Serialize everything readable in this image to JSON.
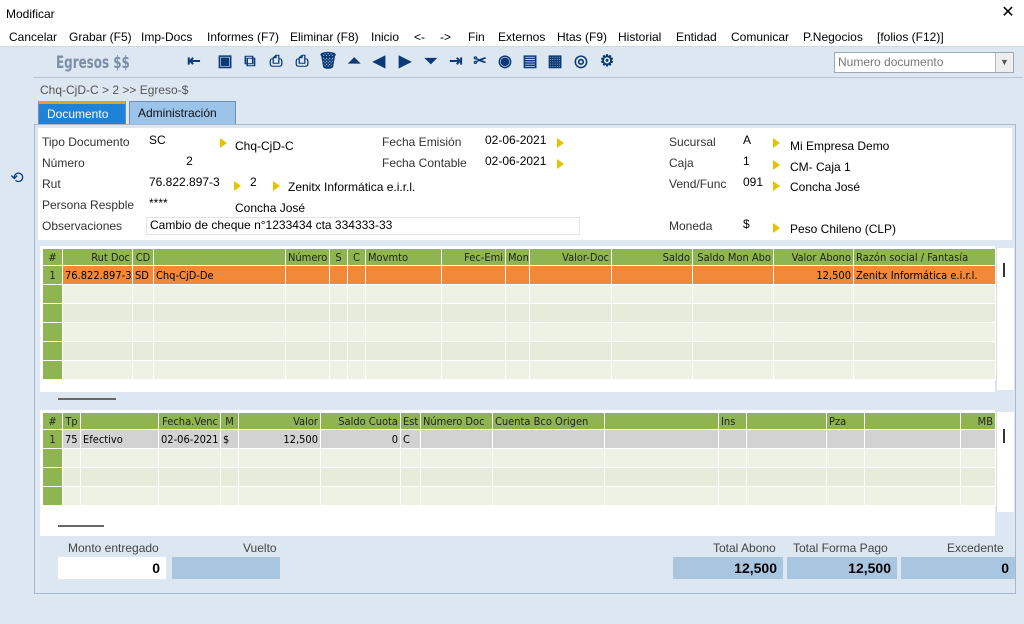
{
  "window": {
    "title": "Modificar",
    "close": "✕"
  },
  "menu": [
    "Cancelar",
    "Grabar (F5)",
    "Imp-Docs",
    "Informes (F7)",
    "Eliminar (F8)",
    "Inicio",
    "<-",
    "->",
    "Fin",
    "Externos",
    "Htas (F9)",
    "Historial",
    "Entidad",
    "Comunicar",
    "P.Negocios",
    "[folios (F12)]"
  ],
  "toolbar": {
    "brand": "Egresos $$",
    "search_placeholder": "Numero documento"
  },
  "breadcrumb": "Chq-CjD-C > 2 >> Egreso-$",
  "tabs": [
    "Documento",
    "Administración"
  ],
  "form": {
    "tipo_label": "Tipo Documento",
    "tipo": "SC",
    "tipo_desc": "Chq-CjD-C",
    "numero_label": "Número",
    "numero": "2",
    "rut_label": "Rut",
    "rut": "76.822.897-3",
    "rut_suc": "2",
    "rut_name": "Zenitx Informática e.i.r.l.",
    "persona_label": "Persona Respble",
    "persona": "****",
    "persona_name": "Concha José",
    "obs_label": "Observaciones",
    "obs": "Cambio de cheque n°1233434 cta 334333-33",
    "fecha_emision_label": "Fecha Emisión",
    "fecha_emision": "02-06-2021",
    "fecha_contable_label": "Fecha Contable",
    "fecha_contable": "02-06-2021",
    "sucursal_label": "Sucursal",
    "sucursal": "A",
    "sucursal_desc": "Mi Empresa Demo",
    "caja_label": "Caja",
    "caja": "1",
    "caja_desc": "CM- Caja 1",
    "vend_label": "Vend/Func",
    "vend": "091",
    "vend_desc": "Concha José",
    "moneda_label": "Moneda",
    "moneda": "$",
    "moneda_desc": "Peso Chileno (CLP)"
  },
  "grid1": {
    "headers": [
      "#",
      "Rut Doc",
      "CD",
      "",
      "Número",
      "S",
      "C",
      "Movmto",
      "Fec-Emi",
      "Mon",
      "Valor-Doc",
      "Saldo",
      "Saldo Mon Abo",
      "Valor Abono",
      "Razón social / Fantasía"
    ],
    "rows": [
      [
        "1",
        "76.822.897-3",
        "SD",
        "Chq-CjD-De",
        "",
        "",
        "",
        "",
        "",
        "",
        "",
        "",
        "",
        "12,500",
        "Zenitx Informática e.i.r.l."
      ]
    ]
  },
  "grid2": {
    "headers": [
      "#",
      "Tp",
      "",
      "Fecha.Venc",
      "M",
      "Valor",
      "Saldo Cuota",
      "Est",
      "Número Doc",
      "Cuenta Bco Origen",
      "",
      "Ins",
      "",
      "Pza",
      "",
      "MB"
    ],
    "rows": [
      [
        "1",
        "75",
        "Efectivo",
        "02-06-2021",
        "$",
        "12,500",
        "0",
        "C",
        "",
        "",
        "",
        "",
        "",
        "",
        "",
        ""
      ]
    ]
  },
  "bottom": {
    "monto_label": "Monto entregado",
    "monto": "0",
    "vuelto_label": "Vuelto",
    "vuelto": "",
    "total_abono_label": "Total Abono",
    "total_abono": "12,500",
    "total_fp_label": "Total Forma Pago",
    "total_fp": "12,500",
    "excedente_label": "Excedente",
    "excedente": "0"
  },
  "colors": {
    "header_green": "#8fb553",
    "row_orange": "#f08a3a",
    "tab_active": "#1d82d8",
    "arrow_yellow": "#e6c200"
  }
}
